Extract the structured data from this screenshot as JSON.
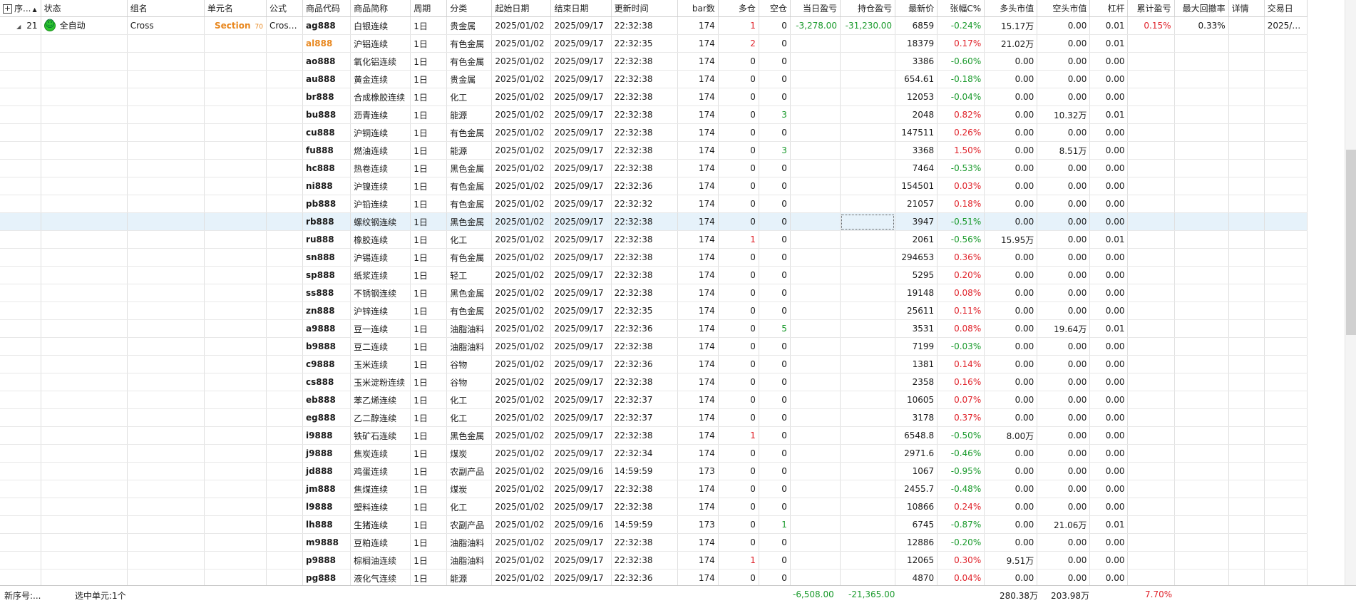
{
  "headers": [
    {
      "label": "序...",
      "sort": "▲"
    },
    {
      "label": "状态"
    },
    {
      "label": "组名"
    },
    {
      "label": "单元名"
    },
    {
      "label": "公式"
    },
    {
      "label": "商品代码"
    },
    {
      "label": "商品简称"
    },
    {
      "label": "周期"
    },
    {
      "label": "分类"
    },
    {
      "label": "起始日期"
    },
    {
      "label": "结束日期"
    },
    {
      "label": "更新时间"
    },
    {
      "label": "bar数"
    },
    {
      "label": "多仓"
    },
    {
      "label": "空仓"
    },
    {
      "label": "当日盈亏"
    },
    {
      "label": "持仓盈亏"
    },
    {
      "label": "最新价"
    },
    {
      "label": "张幅C%"
    },
    {
      "label": "多头市值"
    },
    {
      "label": "空头市值"
    },
    {
      "label": "杠杆"
    },
    {
      "label": "累计盈亏"
    },
    {
      "label": "最大回撤率"
    },
    {
      "label": "详情"
    },
    {
      "label": "交易日"
    }
  ],
  "group_row": {
    "seq": "21",
    "status": "全自动",
    "group": "Cross",
    "unit": "Section",
    "unit_sub": "70",
    "formula": "Cross...",
    "code": "ag888",
    "name": "白银连续",
    "period": "1日",
    "category": "贵金属",
    "start": "2025/01/02",
    "end": "2025/09/17",
    "time": "22:32:38",
    "bars": "174",
    "long": "1",
    "short": "0",
    "day_pnl": "-3,278.00",
    "pos_pnl": "-31,230.00",
    "price": "6859",
    "chg": "-0.24%",
    "long_val": "15.17万",
    "short_val": "0.00",
    "lev": "0.01",
    "cum_pnl": "0.15%",
    "max_dd": "0.33%",
    "detail": "",
    "trade_day": "2025/0..."
  },
  "rows": [
    {
      "code": "al888",
      "name": "沪铝连续",
      "period": "1日",
      "category": "有色金属",
      "start": "2025/01/02",
      "end": "2025/09/17",
      "time": "22:32:35",
      "bars": "174",
      "long": "2",
      "short": "0",
      "price": "18379",
      "chg": "0.17%",
      "long_val": "21.02万",
      "short_val": "0.00",
      "lev": "0.01"
    },
    {
      "code": "ao888",
      "name": "氧化铝连续",
      "period": "1日",
      "category": "有色金属",
      "start": "2025/01/02",
      "end": "2025/09/17",
      "time": "22:32:38",
      "bars": "174",
      "long": "0",
      "short": "0",
      "price": "3386",
      "chg": "-0.60%",
      "long_val": "0.00",
      "short_val": "0.00",
      "lev": "0.00"
    },
    {
      "code": "au888",
      "name": "黄金连续",
      "period": "1日",
      "category": "贵金属",
      "start": "2025/01/02",
      "end": "2025/09/17",
      "time": "22:32:38",
      "bars": "174",
      "long": "0",
      "short": "0",
      "price": "654.61",
      "chg": "-0.18%",
      "long_val": "0.00",
      "short_val": "0.00",
      "lev": "0.00"
    },
    {
      "code": "br888",
      "name": "合成橡胶连续",
      "period": "1日",
      "category": "化工",
      "start": "2025/01/02",
      "end": "2025/09/17",
      "time": "22:32:38",
      "bars": "174",
      "long": "0",
      "short": "0",
      "price": "12053",
      "chg": "-0.04%",
      "long_val": "0.00",
      "short_val": "0.00",
      "lev": "0.00"
    },
    {
      "code": "bu888",
      "name": "沥青连续",
      "period": "1日",
      "category": "能源",
      "start": "2025/01/02",
      "end": "2025/09/17",
      "time": "22:32:38",
      "bars": "174",
      "long": "0",
      "short": "3",
      "price": "2048",
      "chg": "0.82%",
      "long_val": "0.00",
      "short_val": "10.32万",
      "lev": "0.01"
    },
    {
      "code": "cu888",
      "name": "沪铜连续",
      "period": "1日",
      "category": "有色金属",
      "start": "2025/01/02",
      "end": "2025/09/17",
      "time": "22:32:38",
      "bars": "174",
      "long": "0",
      "short": "0",
      "price": "147511",
      "chg": "0.26%",
      "long_val": "0.00",
      "short_val": "0.00",
      "lev": "0.00"
    },
    {
      "code": "fu888",
      "name": "燃油连续",
      "period": "1日",
      "category": "能源",
      "start": "2025/01/02",
      "end": "2025/09/17",
      "time": "22:32:38",
      "bars": "174",
      "long": "0",
      "short": "3",
      "price": "3368",
      "chg": "1.50%",
      "long_val": "0.00",
      "short_val": "8.51万",
      "lev": "0.00"
    },
    {
      "code": "hc888",
      "name": "热卷连续",
      "period": "1日",
      "category": "黑色金属",
      "start": "2025/01/02",
      "end": "2025/09/17",
      "time": "22:32:38",
      "bars": "174",
      "long": "0",
      "short": "0",
      "price": "7464",
      "chg": "-0.53%",
      "long_val": "0.00",
      "short_val": "0.00",
      "lev": "0.00"
    },
    {
      "code": "ni888",
      "name": "沪镍连续",
      "period": "1日",
      "category": "有色金属",
      "start": "2025/01/02",
      "end": "2025/09/17",
      "time": "22:32:36",
      "bars": "174",
      "long": "0",
      "short": "0",
      "price": "154501",
      "chg": "0.03%",
      "long_val": "0.00",
      "short_val": "0.00",
      "lev": "0.00"
    },
    {
      "code": "pb888",
      "name": "沪铅连续",
      "period": "1日",
      "category": "有色金属",
      "start": "2025/01/02",
      "end": "2025/09/17",
      "time": "22:32:32",
      "bars": "174",
      "long": "0",
      "short": "0",
      "price": "21057",
      "chg": "0.18%",
      "long_val": "0.00",
      "short_val": "0.00",
      "lev": "0.00"
    },
    {
      "code": "rb888",
      "name": "螺纹钢连续",
      "period": "1日",
      "category": "黑色金属",
      "start": "2025/01/02",
      "end": "2025/09/17",
      "time": "22:32:38",
      "bars": "174",
      "long": "0",
      "short": "0",
      "price": "3947",
      "chg": "-0.51%",
      "long_val": "0.00",
      "short_val": "0.00",
      "lev": "0.00"
    },
    {
      "code": "ru888",
      "name": "橡胶连续",
      "period": "1日",
      "category": "化工",
      "start": "2025/01/02",
      "end": "2025/09/17",
      "time": "22:32:38",
      "bars": "174",
      "long": "1",
      "short": "0",
      "price": "2061",
      "chg": "-0.56%",
      "long_val": "15.95万",
      "short_val": "0.00",
      "lev": "0.01"
    },
    {
      "code": "sn888",
      "name": "沪锡连续",
      "period": "1日",
      "category": "有色金属",
      "start": "2025/01/02",
      "end": "2025/09/17",
      "time": "22:32:38",
      "bars": "174",
      "long": "0",
      "short": "0",
      "price": "294653",
      "chg": "0.36%",
      "long_val": "0.00",
      "short_val": "0.00",
      "lev": "0.00"
    },
    {
      "code": "sp888",
      "name": "纸浆连续",
      "period": "1日",
      "category": "轻工",
      "start": "2025/01/02",
      "end": "2025/09/17",
      "time": "22:32:38",
      "bars": "174",
      "long": "0",
      "short": "0",
      "price": "5295",
      "chg": "0.20%",
      "long_val": "0.00",
      "short_val": "0.00",
      "lev": "0.00"
    },
    {
      "code": "ss888",
      "name": "不锈钢连续",
      "period": "1日",
      "category": "黑色金属",
      "start": "2025/01/02",
      "end": "2025/09/17",
      "time": "22:32:38",
      "bars": "174",
      "long": "0",
      "short": "0",
      "price": "19148",
      "chg": "0.08%",
      "long_val": "0.00",
      "short_val": "0.00",
      "lev": "0.00"
    },
    {
      "code": "zn888",
      "name": "沪锌连续",
      "period": "1日",
      "category": "有色金属",
      "start": "2025/01/02",
      "end": "2025/09/17",
      "time": "22:32:35",
      "bars": "174",
      "long": "0",
      "short": "0",
      "price": "25611",
      "chg": "0.11%",
      "long_val": "0.00",
      "short_val": "0.00",
      "lev": "0.00"
    },
    {
      "code": "a9888",
      "name": "豆一连续",
      "period": "1日",
      "category": "油脂油料",
      "start": "2025/01/02",
      "end": "2025/09/17",
      "time": "22:32:36",
      "bars": "174",
      "long": "0",
      "short": "5",
      "price": "3531",
      "chg": "0.08%",
      "long_val": "0.00",
      "short_val": "19.64万",
      "lev": "0.01"
    },
    {
      "code": "b9888",
      "name": "豆二连续",
      "period": "1日",
      "category": "油脂油料",
      "start": "2025/01/02",
      "end": "2025/09/17",
      "time": "22:32:38",
      "bars": "174",
      "long": "0",
      "short": "0",
      "price": "7199",
      "chg": "-0.03%",
      "long_val": "0.00",
      "short_val": "0.00",
      "lev": "0.00"
    },
    {
      "code": "c9888",
      "name": "玉米连续",
      "period": "1日",
      "category": "谷物",
      "start": "2025/01/02",
      "end": "2025/09/17",
      "time": "22:32:36",
      "bars": "174",
      "long": "0",
      "short": "0",
      "price": "1381",
      "chg": "0.14%",
      "long_val": "0.00",
      "short_val": "0.00",
      "lev": "0.00"
    },
    {
      "code": "cs888",
      "name": "玉米淀粉连续",
      "period": "1日",
      "category": "谷物",
      "start": "2025/01/02",
      "end": "2025/09/17",
      "time": "22:32:38",
      "bars": "174",
      "long": "0",
      "short": "0",
      "price": "2358",
      "chg": "0.16%",
      "long_val": "0.00",
      "short_val": "0.00",
      "lev": "0.00"
    },
    {
      "code": "eb888",
      "name": "苯乙烯连续",
      "period": "1日",
      "category": "化工",
      "start": "2025/01/02",
      "end": "2025/09/17",
      "time": "22:32:37",
      "bars": "174",
      "long": "0",
      "short": "0",
      "price": "10605",
      "chg": "0.07%",
      "long_val": "0.00",
      "short_val": "0.00",
      "lev": "0.00"
    },
    {
      "code": "eg888",
      "name": "乙二醇连续",
      "period": "1日",
      "category": "化工",
      "start": "2025/01/02",
      "end": "2025/09/17",
      "time": "22:32:37",
      "bars": "174",
      "long": "0",
      "short": "0",
      "price": "3178",
      "chg": "0.37%",
      "long_val": "0.00",
      "short_val": "0.00",
      "lev": "0.00"
    },
    {
      "code": "i9888",
      "name": "铁矿石连续",
      "period": "1日",
      "category": "黑色金属",
      "start": "2025/01/02",
      "end": "2025/09/17",
      "time": "22:32:38",
      "bars": "174",
      "long": "1",
      "short": "0",
      "price": "6548.8",
      "chg": "-0.50%",
      "long_val": "8.00万",
      "short_val": "0.00",
      "lev": "0.00"
    },
    {
      "code": "j9888",
      "name": "焦炭连续",
      "period": "1日",
      "category": "煤炭",
      "start": "2025/01/02",
      "end": "2025/09/17",
      "time": "22:32:34",
      "bars": "174",
      "long": "0",
      "short": "0",
      "price": "2971.6",
      "chg": "-0.46%",
      "long_val": "0.00",
      "short_val": "0.00",
      "lev": "0.00"
    },
    {
      "code": "jd888",
      "name": "鸡蛋连续",
      "period": "1日",
      "category": "农副产品",
      "start": "2025/01/02",
      "end": "2025/09/16",
      "time": "14:59:59",
      "bars": "173",
      "long": "0",
      "short": "0",
      "price": "1067",
      "chg": "-0.95%",
      "long_val": "0.00",
      "short_val": "0.00",
      "lev": "0.00"
    },
    {
      "code": "jm888",
      "name": "焦煤连续",
      "period": "1日",
      "category": "煤炭",
      "start": "2025/01/02",
      "end": "2025/09/17",
      "time": "22:32:38",
      "bars": "174",
      "long": "0",
      "short": "0",
      "price": "2455.7",
      "chg": "-0.48%",
      "long_val": "0.00",
      "short_val": "0.00",
      "lev": "0.00"
    },
    {
      "code": "l9888",
      "name": "塑料连续",
      "period": "1日",
      "category": "化工",
      "start": "2025/01/02",
      "end": "2025/09/17",
      "time": "22:32:38",
      "bars": "174",
      "long": "0",
      "short": "0",
      "price": "10866",
      "chg": "0.24%",
      "long_val": "0.00",
      "short_val": "0.00",
      "lev": "0.00"
    },
    {
      "code": "lh888",
      "name": "生猪连续",
      "period": "1日",
      "category": "农副产品",
      "start": "2025/01/02",
      "end": "2025/09/16",
      "time": "14:59:59",
      "bars": "173",
      "long": "0",
      "short": "1",
      "price": "6745",
      "chg": "-0.87%",
      "long_val": "0.00",
      "short_val": "21.06万",
      "lev": "0.01"
    },
    {
      "code": "m9888",
      "name": "豆粕连续",
      "period": "1日",
      "category": "油脂油料",
      "start": "2025/01/02",
      "end": "2025/09/17",
      "time": "22:32:38",
      "bars": "174",
      "long": "0",
      "short": "0",
      "price": "12886",
      "chg": "-0.20%",
      "long_val": "0.00",
      "short_val": "0.00",
      "lev": "0.00"
    },
    {
      "code": "p9888",
      "name": "棕榈油连续",
      "period": "1日",
      "category": "油脂油料",
      "start": "2025/01/02",
      "end": "2025/09/17",
      "time": "22:32:38",
      "bars": "174",
      "long": "1",
      "short": "0",
      "price": "12065",
      "chg": "0.30%",
      "long_val": "9.51万",
      "short_val": "0.00",
      "lev": "0.00"
    },
    {
      "code": "pg888",
      "name": "液化气连续",
      "period": "1日",
      "category": "能源",
      "start": "2025/01/02",
      "end": "2025/09/17",
      "time": "22:32:36",
      "bars": "174",
      "long": "0",
      "short": "0",
      "price": "4870",
      "chg": "0.04%",
      "long_val": "0.00",
      "short_val": "0.00",
      "lev": "0.00"
    }
  ],
  "footer": {
    "new_seq": "新序号:...",
    "selected": "选中单元:1个",
    "day_pnl": "-6,508.00",
    "pos_pnl": "-21,365.00",
    "long_val": "280.38万",
    "short_val": "203.98万",
    "cum_pnl": "7.70%"
  },
  "colors": {
    "up": "#e0232b",
    "down": "#1a9a2c",
    "accent": "#e8871e",
    "highlight": "#e6f2fa"
  }
}
